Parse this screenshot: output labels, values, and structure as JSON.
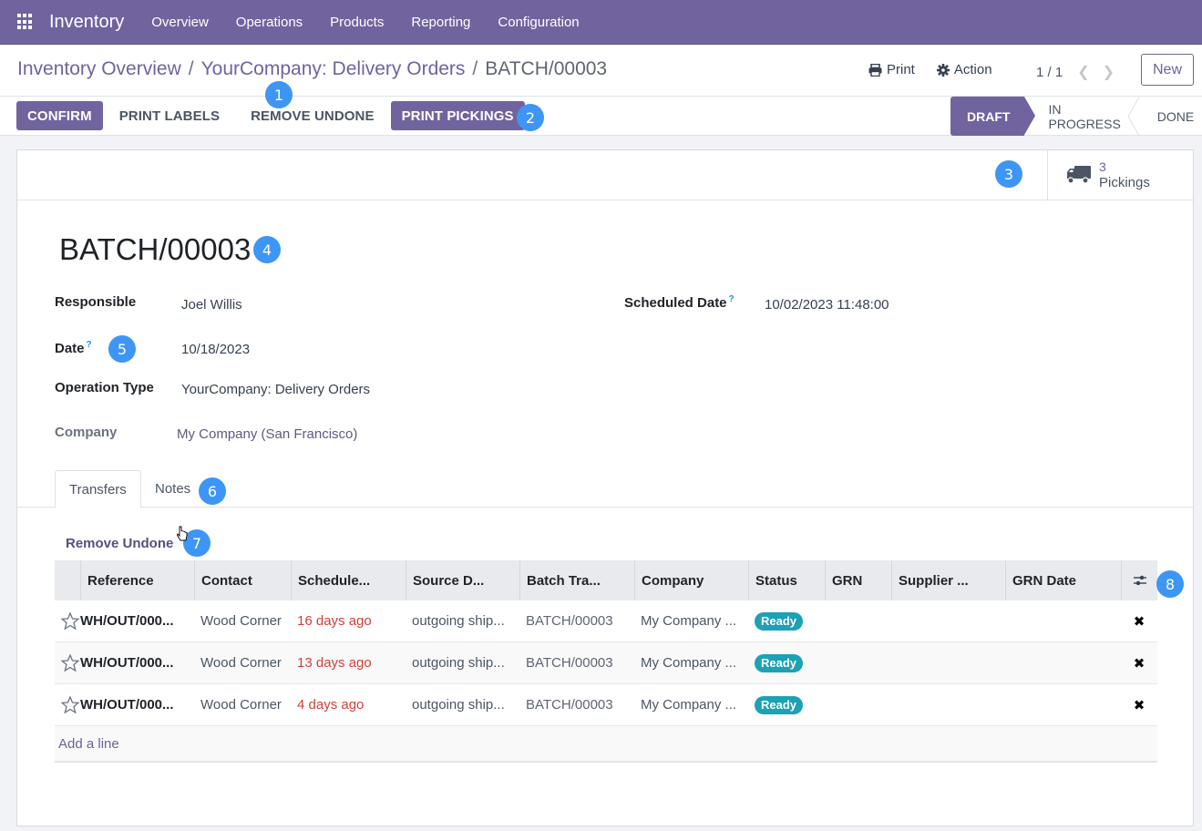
{
  "navbar": {
    "app_name": "Inventory",
    "menu": [
      "Overview",
      "Operations",
      "Products",
      "Reporting",
      "Configuration"
    ]
  },
  "breadcrumb": [
    "Inventory Overview",
    "YourCompany: Delivery Orders",
    "BATCH/00003"
  ],
  "breadcrumb_separator": "/",
  "control_panel": {
    "print_label": "Print",
    "action_label": "Action",
    "pager": "1 / 1",
    "new_label": "New"
  },
  "header_buttons": {
    "confirm": "CONFIRM",
    "print_labels": "PRINT LABELS",
    "remove_undone": "REMOVE UNDONE",
    "print_pickings": "PRINT PICKINGS"
  },
  "statusbar": {
    "stages": [
      "DRAFT",
      "IN PROGRESS",
      "DONE"
    ],
    "current": "DRAFT"
  },
  "smart_button": {
    "count": "3",
    "label": "Pickings"
  },
  "record": {
    "title": "BATCH/00003",
    "fields": {
      "responsible_label": "Responsible",
      "responsible": "Joel Willis",
      "date_label": "Date",
      "date": "10/18/2023",
      "operation_type_label": "Operation Type",
      "operation_type": "YourCompany: Delivery Orders",
      "company_label": "Company",
      "company": "My Company (San Francisco)",
      "scheduled_date_label": "Scheduled Date",
      "scheduled_date": "10/02/2023 11:48:00",
      "help_marker": "?"
    }
  },
  "tabs": [
    "Transfers",
    "Notes"
  ],
  "transfers": {
    "remove_undone_link": "Remove Undone",
    "columns": [
      "Reference",
      "Contact",
      "Schedule...",
      "Source D...",
      "Batch Tra...",
      "Company",
      "Status",
      "GRN",
      "Supplier ...",
      "GRN Date"
    ],
    "rows": [
      {
        "reference": "WH/OUT/000...",
        "contact": "Wood Corner",
        "scheduled": "16 days ago",
        "source": "outgoing ship...",
        "batch": "BATCH/00003",
        "company": "My Company ...",
        "status": "Ready"
      },
      {
        "reference": "WH/OUT/000...",
        "contact": "Wood Corner",
        "scheduled": "13 days ago",
        "source": "outgoing ship...",
        "batch": "BATCH/00003",
        "company": "My Company ...",
        "status": "Ready"
      },
      {
        "reference": "WH/OUT/000...",
        "contact": "Wood Corner",
        "scheduled": "4 days ago",
        "source": "outgoing ship...",
        "batch": "BATCH/00003",
        "company": "My Company ...",
        "status": "Ready"
      }
    ],
    "add_line": "Add a line",
    "delete_glyph": "✖"
  },
  "annotations": [
    "1",
    "2",
    "3",
    "4",
    "5",
    "6",
    "7",
    "8"
  ],
  "colors": {
    "brand": "#71639e",
    "status_ready": "#1ca1b5",
    "late_date": "#d23f3a",
    "marker": "#3d96f5"
  }
}
